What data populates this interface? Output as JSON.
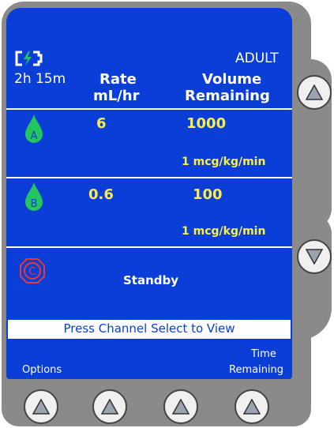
{
  "status": {
    "battery_time": "2h 15m",
    "mode": "ADULT"
  },
  "headers": {
    "rate_line1": "Rate",
    "rate_line2": "mL/hr",
    "volume_line1": "Volume",
    "volume_line2": "Remaining"
  },
  "channels": [
    {
      "letter": "A",
      "rate": "6",
      "volume": "1000",
      "dose": "1 mcg/kg/min",
      "color": "#22c55e"
    },
    {
      "letter": "B",
      "rate": "0.6",
      "volume": "100",
      "dose": "1 mcg/kg/min",
      "color": "#22c55e"
    },
    {
      "letter": "C",
      "status": "Standby",
      "color": "#e53935"
    }
  ],
  "message": "Press Channel Select to View",
  "softkeys": {
    "left_label": "Options",
    "right_label_line1": "Time",
    "right_label_line2": "Remaining"
  },
  "colors": {
    "screen": "#0a3ed6",
    "value_yellow": "#f7ee4b",
    "bezel": "#8a8a8a"
  },
  "icons": {
    "battery": "battery-charging-icon",
    "scroll_up": "up-arrow-icon",
    "scroll_down": "down-arrow-icon"
  }
}
